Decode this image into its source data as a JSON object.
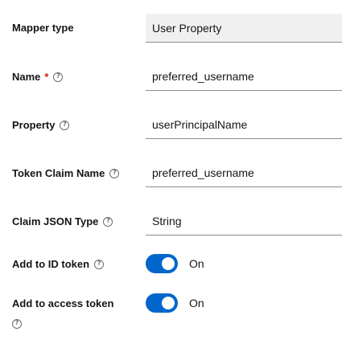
{
  "fields": [
    {
      "label": "Mapper type",
      "required": false,
      "help": false,
      "value": "User Property",
      "readonly": true
    },
    {
      "label": "Name",
      "required": true,
      "help": true,
      "value": "preferred_username",
      "readonly": false
    },
    {
      "label": "Property",
      "required": false,
      "help": true,
      "value": "userPrincipalName",
      "readonly": false
    },
    {
      "label": "Token Claim Name",
      "required": false,
      "help": true,
      "value": "preferred_username",
      "readonly": false
    },
    {
      "label": "Claim JSON Type",
      "required": false,
      "help": true,
      "value": "String",
      "readonly": false
    }
  ],
  "required_marker": "*",
  "toggles": [
    {
      "label": "Add to ID token",
      "state": "On",
      "checked": true
    },
    {
      "label": "Add to access token",
      "state": "On",
      "checked": true
    }
  ],
  "colors": {
    "accent": "#0066cc",
    "required": "#c9190b",
    "readonly_bg": "#f0f0f0"
  }
}
